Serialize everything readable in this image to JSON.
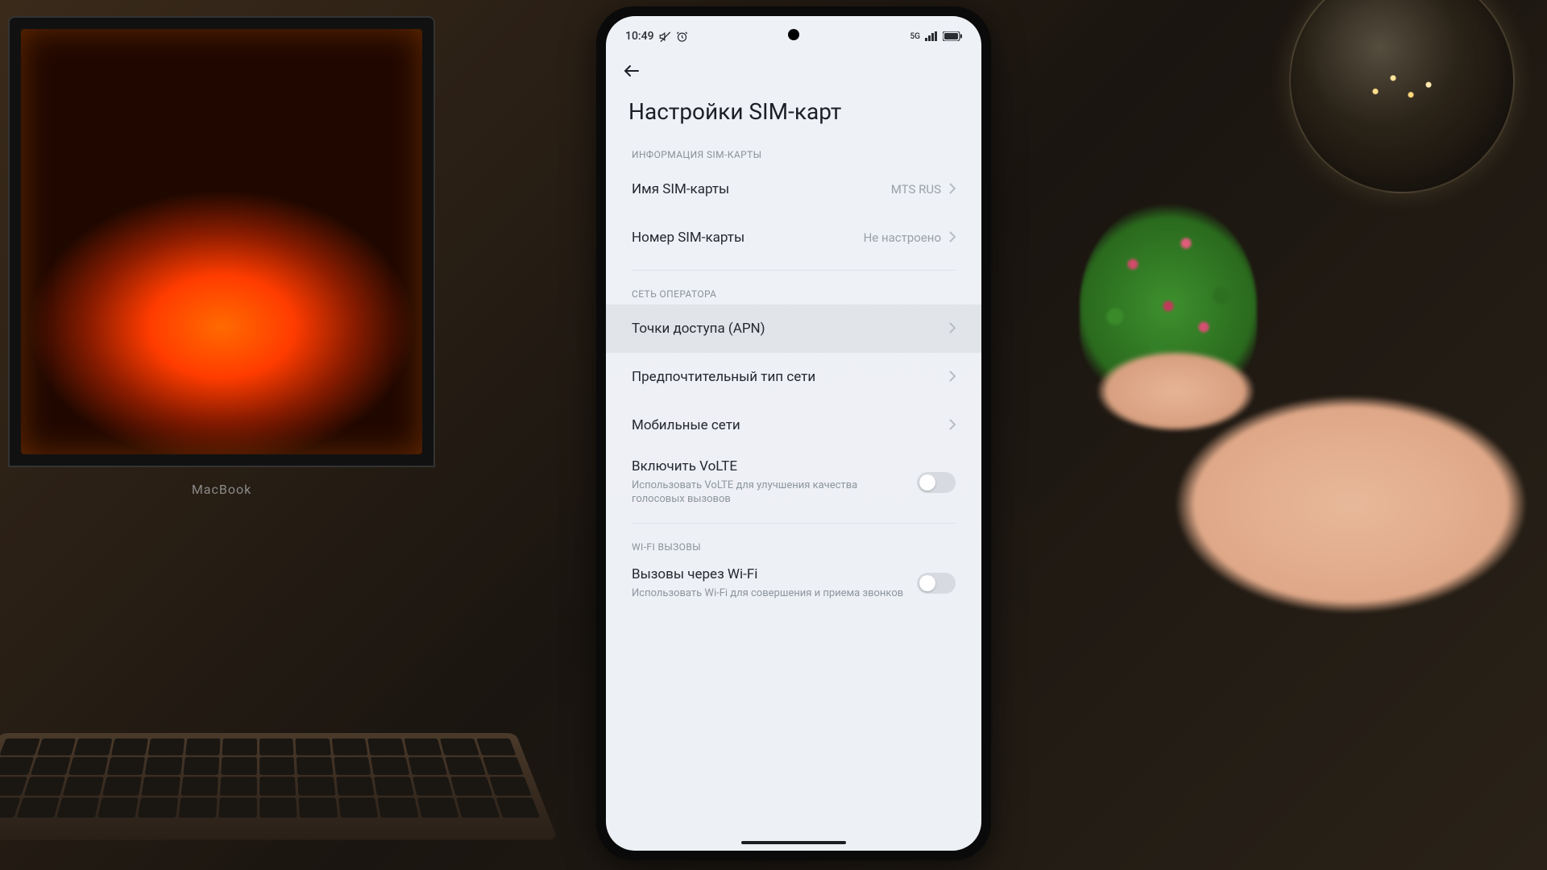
{
  "statusBar": {
    "time": "10:49",
    "icons": {
      "mute": "sound-muted-icon",
      "alarm": "alarm-icon",
      "signal1": "5G",
      "signalBars": 4,
      "battery": "battery-icon"
    }
  },
  "pageTitle": "Настройки SIM-карт",
  "sections": {
    "simInfo": {
      "header": "ИНФОРМАЦИЯ SIM-КАРТЫ",
      "rows": {
        "name": {
          "label": "Имя SIM-карты",
          "value": "MTS RUS"
        },
        "number": {
          "label": "Номер SIM-карты",
          "value": "Не настроено"
        }
      }
    },
    "carrierNet": {
      "header": "СЕТЬ ОПЕРАТОРА",
      "rows": {
        "apn": {
          "label": "Точки доступа (APN)"
        },
        "prefNet": {
          "label": "Предпочтительный тип сети"
        },
        "mobileNets": {
          "label": "Мобильные сети"
        },
        "volte": {
          "label": "Включить VoLTE",
          "sub": "Использовать VoLTE для улучшения качества голосовых вызовов",
          "on": false
        }
      }
    },
    "wifiCalls": {
      "header": "WI-FI ВЫЗОВЫ",
      "rows": {
        "wifiCalling": {
          "label": "Вызовы через Wi-Fi",
          "sub": "Использовать Wi-Fi для совершения и приема звонков",
          "on": false
        }
      }
    }
  },
  "scene": {
    "laptopBrand": "MacBook"
  }
}
